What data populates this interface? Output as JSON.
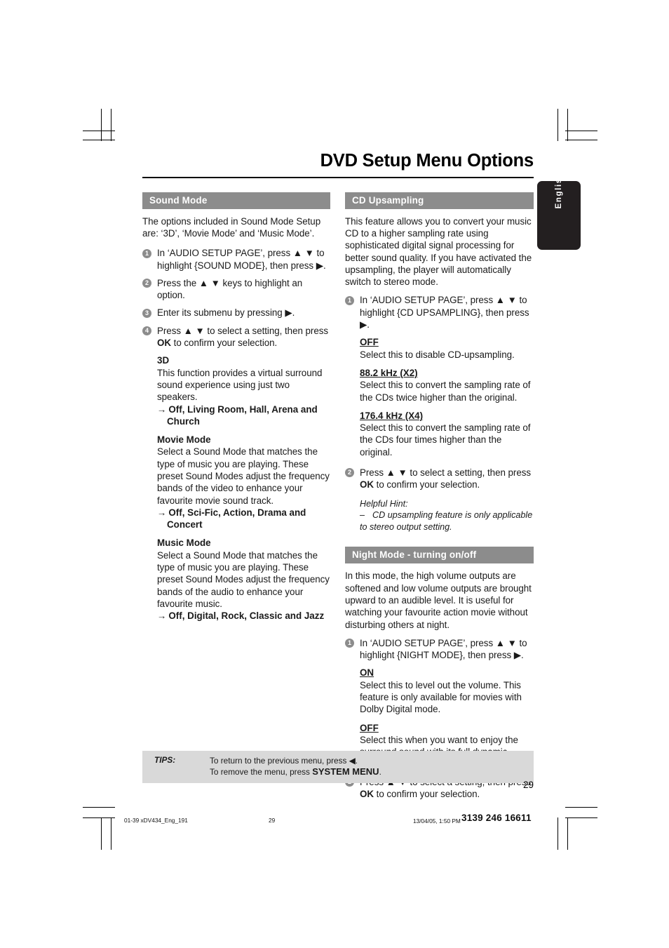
{
  "page": {
    "title": "DVD Setup Menu Options",
    "language_tab": "English",
    "page_number": "29"
  },
  "left_column": {
    "section": {
      "header": "Sound Mode",
      "intro": "The options included in Sound Mode Setup are: ‘3D’, ‘Movie Mode’ and ‘Music Mode’.",
      "steps": [
        {
          "num": "1",
          "text_before": "In ‘AUDIO SETUP PAGE’, press ▲ ▼ to highlight {SOUND MODE}, then press ▶."
        },
        {
          "num": "2",
          "text_before": "Press the ▲ ▼ keys to highlight an option."
        },
        {
          "num": "3",
          "text_before": "Enter its submenu by pressing ▶."
        },
        {
          "num": "4",
          "text_before": "Press ▲ ▼ to select a setting, then press ",
          "bold": "OK",
          "text_after": " to confirm your selection."
        }
      ],
      "subsections": [
        {
          "title": "3D",
          "body": "This function provides a virtual surround sound experience using just two speakers.",
          "options": "Off, Living Room, Hall, Arena and Church"
        },
        {
          "title": "Movie Mode",
          "body": "Select a Sound Mode that matches the type of music you are playing. These preset Sound Modes adjust the frequency bands of the video to enhance your favourite movie sound track.",
          "options": "Off, Sci-Fic, Action, Drama and Concert"
        },
        {
          "title": "Music Mode",
          "body": "Select a Sound Mode that matches the type of music you are playing. These preset Sound Modes adjust the frequency bands of the audio to enhance your favourite music.",
          "options": "Off, Digital, Rock, Classic and Jazz"
        }
      ]
    }
  },
  "right_column": {
    "cd_upsampling": {
      "header": "CD Upsampling",
      "intro": "This feature allows you to convert your music CD to a higher sampling rate using sophisticated digital signal processing for better sound quality. If you have activated the upsampling, the player will automatically switch to stereo mode.",
      "step1": {
        "num": "1",
        "text": "In ‘AUDIO SETUP PAGE’, press ▲ ▼ to highlight {CD UPSAMPLING}, then press ▶."
      },
      "options": [
        {
          "title": "OFF",
          "body": "Select this to disable CD-upsampling."
        },
        {
          "title": "88.2 kHz (X2)",
          "body": "Select this to convert the sampling rate of the CDs twice higher than the original."
        },
        {
          "title": "176.4 kHz (X4)",
          "body": "Select this to convert the sampling rate of the CDs four times higher than the original."
        }
      ],
      "step2": {
        "num": "2",
        "text_before": "Press ▲ ▼ to select a setting, then press ",
        "bold": "OK",
        "text_after": " to confirm your selection."
      },
      "hint_label": "Helpful Hint:",
      "hint_text": "CD upsampling feature is only applicable to stereo output setting."
    },
    "night_mode": {
      "header": "Night Mode - turning on/off",
      "intro": "In this mode, the high volume outputs are softened and low volume outputs are brought upward to an audible level. It is useful for watching your favourite action movie without disturbing others at night.",
      "step1": {
        "num": "1",
        "text": "In ‘AUDIO SETUP PAGE’, press ▲ ▼ to highlight {NIGHT MODE}, then press ▶."
      },
      "options": [
        {
          "title": "ON",
          "body": "Select this to level out the volume. This feature is only available for movies with Dolby Digital mode."
        },
        {
          "title": "OFF",
          "body": "Select this when you want to enjoy the surround sound with its full dynamic range."
        }
      ],
      "step2": {
        "num": "2",
        "text_before": "Press ▲ ▼ to select a setting, then press ",
        "bold": "OK",
        "text_after": " to confirm your selection."
      }
    }
  },
  "tips": {
    "label": "TIPS:",
    "line1": "To return to the previous menu, press ◀.",
    "line2_before": "To remove the menu, press ",
    "line2_bold": "SYSTEM MENU",
    "line2_after": "."
  },
  "print_footer": {
    "file": "01-39 xDV434_Eng_191",
    "page": "29",
    "date": "13/04/05, 1:50 PM",
    "code": "3139 246 16611"
  },
  "colors": {
    "section_bar": "#8c8c8c",
    "tips_bar": "#d9d9d9",
    "lang_tab": "#231f20"
  }
}
